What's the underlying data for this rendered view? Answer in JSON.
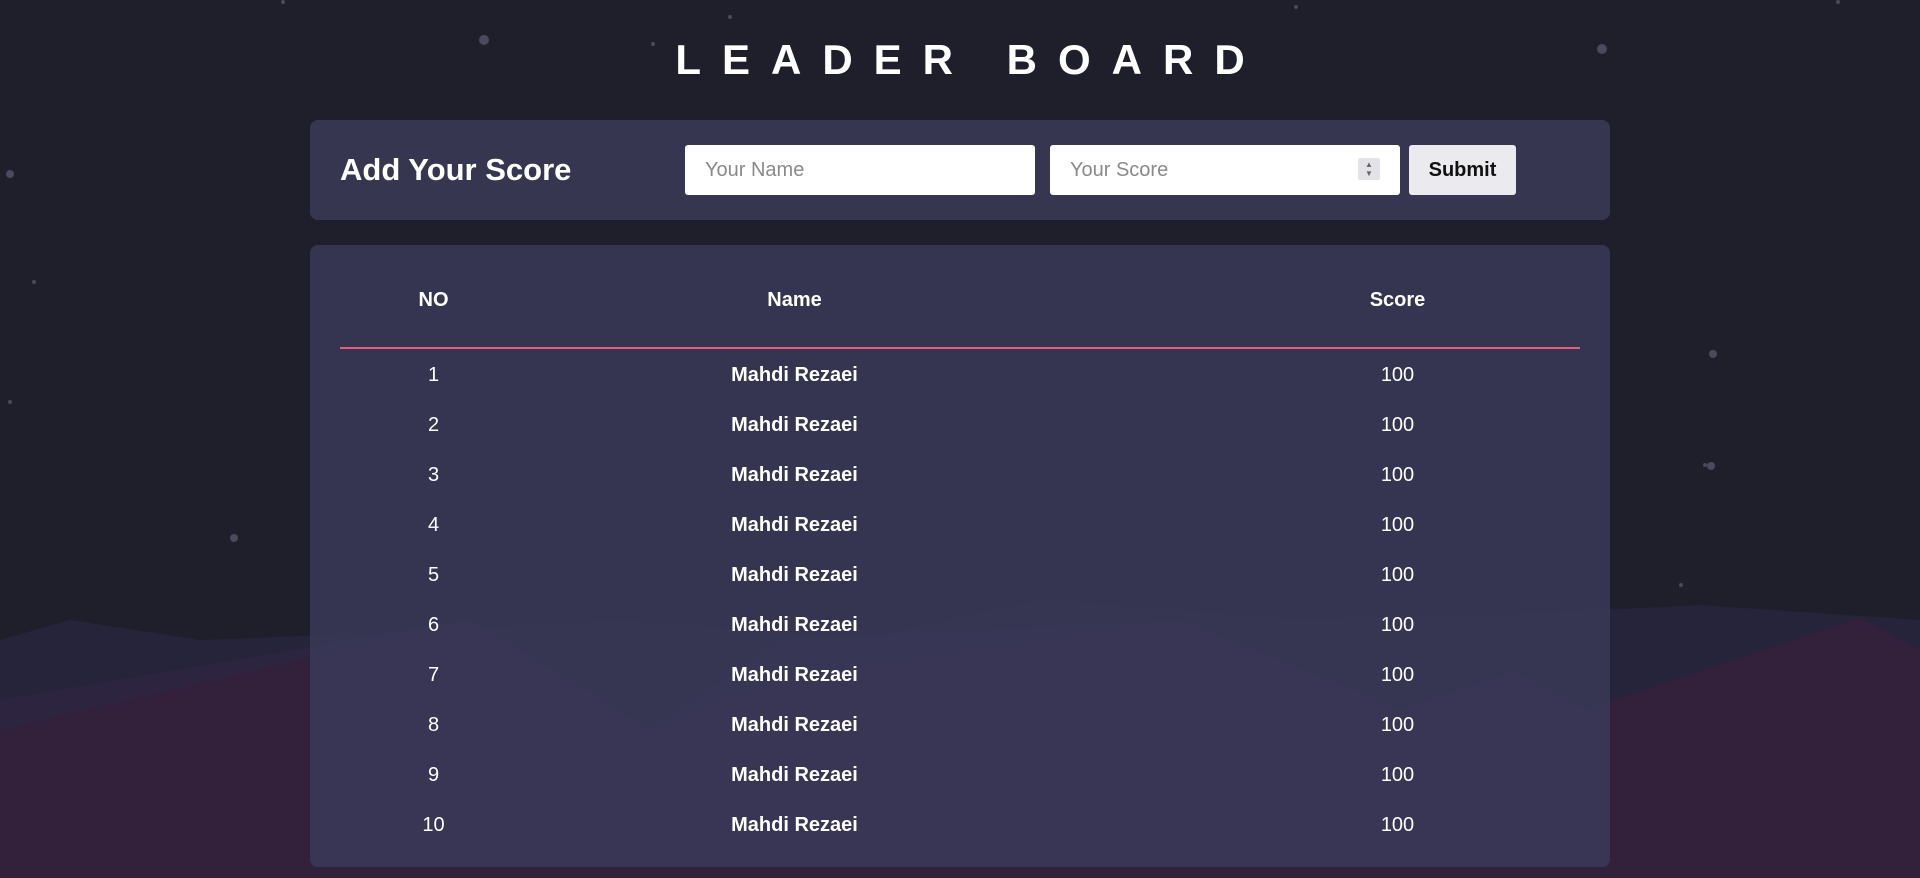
{
  "page": {
    "title": "LEADER BOARD"
  },
  "add_score": {
    "title": "Add Your Score",
    "name_placeholder": "Your Name",
    "score_placeholder": "Your Score",
    "submit_label": "Submit"
  },
  "leaderboard": {
    "columns": [
      "NO",
      "Name",
      "Score"
    ],
    "rows": [
      {
        "no": "1",
        "name": "Mahdi Rezaei",
        "score": "100"
      },
      {
        "no": "2",
        "name": "Mahdi Rezaei",
        "score": "100"
      },
      {
        "no": "3",
        "name": "Mahdi Rezaei",
        "score": "100"
      },
      {
        "no": "4",
        "name": "Mahdi Rezaei",
        "score": "100"
      },
      {
        "no": "5",
        "name": "Mahdi Rezaei",
        "score": "100"
      },
      {
        "no": "6",
        "name": "Mahdi Rezaei",
        "score": "100"
      },
      {
        "no": "7",
        "name": "Mahdi Rezaei",
        "score": "100"
      },
      {
        "no": "8",
        "name": "Mahdi Rezaei",
        "score": "100"
      },
      {
        "no": "9",
        "name": "Mahdi Rezaei",
        "score": "100"
      },
      {
        "no": "10",
        "name": "Mahdi Rezaei",
        "score": "100"
      }
    ]
  },
  "colors": {
    "background": "#1f1e2b",
    "panel": "#383855",
    "accent_line": "#e0607e",
    "mountain_far": "#28263a",
    "mountain_near": "#33223d"
  },
  "icons": {
    "score_spinner": "stepper-arrows-icon"
  }
}
